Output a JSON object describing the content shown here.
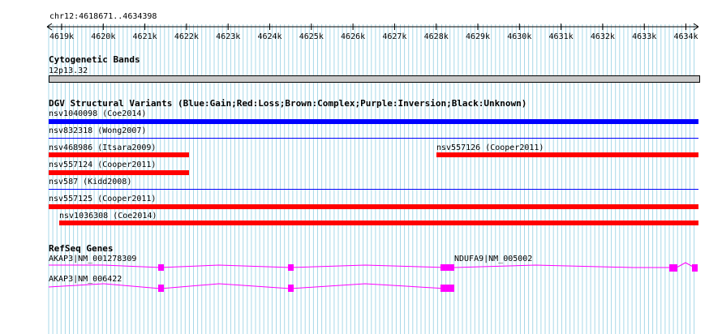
{
  "ruler": {
    "region": "chr12:4618671..4634398",
    "ticks": [
      "4619k",
      "4620k",
      "4621k",
      "4622k",
      "4623k",
      "4624k",
      "4625k",
      "4626k",
      "4627k",
      "4628k",
      "4629k",
      "4630k",
      "4631k",
      "4632k",
      "4633k",
      "4634k"
    ]
  },
  "cytoband": {
    "title": "Cytogenetic Bands",
    "band": "12p13.32"
  },
  "dgv": {
    "title": "DGV Structural Variants (Blue:Gain;Red:Loss;Brown:Complex;Purple:Inversion;Black:Unknown)",
    "colors": {
      "gain": "#0000ff",
      "loss": "#ff0000",
      "divider": "#0000ff"
    },
    "variants": [
      {
        "label": "nsv1040098 (Coe2014)",
        "type": "gain"
      },
      {
        "label": "nsv832318 (Wong2007)",
        "type": "unknown"
      },
      {
        "label": "nsv468986 (Itsara2009)",
        "type": "loss"
      },
      {
        "label": "nsv557126 (Cooper2011)",
        "type": "loss"
      },
      {
        "label": "nsv557124 (Cooper2011)",
        "type": "loss"
      },
      {
        "label": "nsv587 (Kidd2008)",
        "type": "unknown"
      },
      {
        "label": "nsv557125 (Cooper2011)",
        "type": "loss"
      },
      {
        "label": "nsv1036308 (Coe2014)",
        "type": "loss"
      }
    ]
  },
  "refseq": {
    "title": "RefSeq Genes",
    "color": "#ff00ff",
    "genes": [
      {
        "label": "AKAP3|NM_001278309"
      },
      {
        "label": "NDUFA9|NM_005002"
      },
      {
        "label": "AKAP3|NM_006422"
      }
    ]
  },
  "colors": {
    "grid": "#a8d8e8",
    "cytoband_fill": "#c8c8c8"
  }
}
